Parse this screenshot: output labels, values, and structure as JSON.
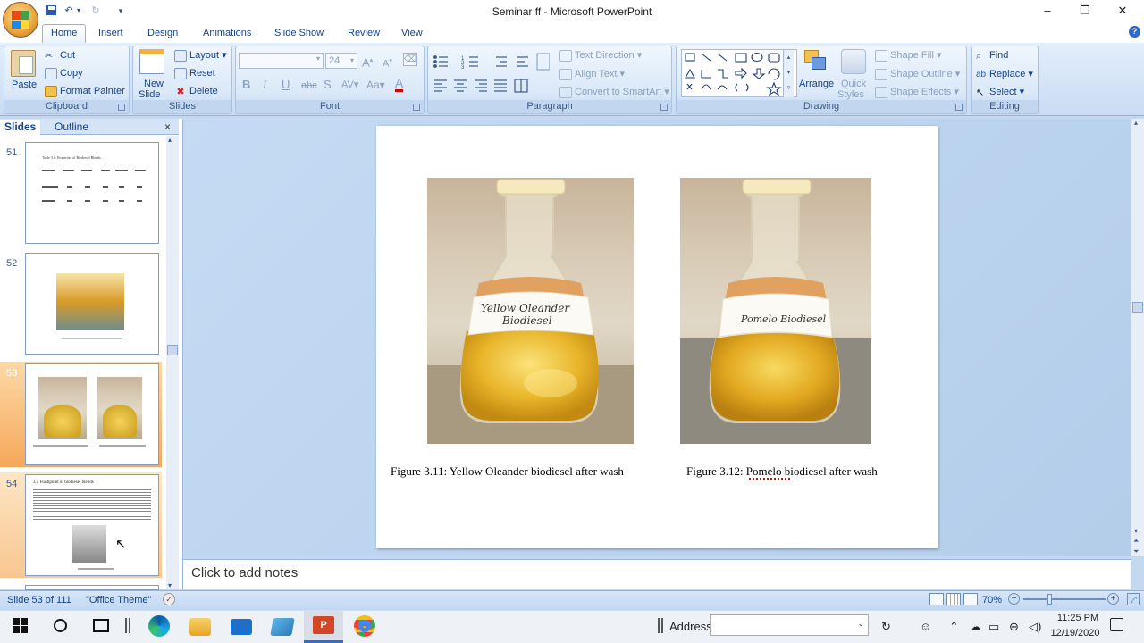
{
  "window": {
    "title": "Seminar ff - Microsoft PowerPoint"
  },
  "tabs": [
    "Home",
    "Insert",
    "Design",
    "Animations",
    "Slide Show",
    "Review",
    "View"
  ],
  "ribbon": {
    "clipboard": {
      "label": "Clipboard",
      "paste": "Paste",
      "cut": "Cut",
      "copy": "Copy",
      "format_painter": "Format Painter"
    },
    "slides": {
      "label": "Slides",
      "new_slide_1": "New",
      "new_slide_2": "Slide",
      "layout": "Layout",
      "reset": "Reset",
      "delete": "Delete"
    },
    "font": {
      "label": "Font",
      "font_name": "",
      "font_size": "24"
    },
    "paragraph": {
      "label": "Paragraph",
      "text_direction": "Text Direction",
      "align_text": "Align Text",
      "convert_smartart": "Convert to SmartArt"
    },
    "drawing": {
      "label": "Drawing",
      "arrange": "Arrange",
      "quick_styles_1": "Quick",
      "quick_styles_2": "Styles",
      "shape_fill": "Shape Fill",
      "shape_outline": "Shape Outline",
      "shape_effects": "Shape Effects"
    },
    "editing": {
      "label": "Editing",
      "find": "Find",
      "replace": "Replace",
      "select": "Select"
    }
  },
  "left_pane": {
    "tab_slides": "Slides",
    "tab_outline": "Outline",
    "thumbnails": [
      {
        "num": "51",
        "caption": "Table 3.1: Properties of Biodiesel Blends"
      },
      {
        "num": "52",
        "caption": ""
      },
      {
        "num": "53",
        "caption": ""
      },
      {
        "num": "54",
        "caption": "3.4 Flashpoint of biodiesel blends"
      }
    ]
  },
  "slide": {
    "caption_left": "Figure 3.11: Yellow Oleander biodiesel after wash",
    "caption_right": "Figure 3.12: Pomelo biodiesel after wash",
    "label_left_1": "Yellow Oleander",
    "label_left_2": "Biodiesel",
    "label_right": "Pomelo Biodiesel"
  },
  "notes": {
    "placeholder": "Click to add notes"
  },
  "status": {
    "slide_info": "Slide 53 of 111",
    "theme": "\"Office Theme\"",
    "zoom": "70%"
  },
  "taskbar": {
    "address_label": "Address",
    "time": "11:25 PM",
    "date": "12/19/2020"
  },
  "colors": {
    "accent": "#15428b",
    "selected_thumb": "#f6a85a",
    "ribbon_bg": "#dae8f8"
  }
}
